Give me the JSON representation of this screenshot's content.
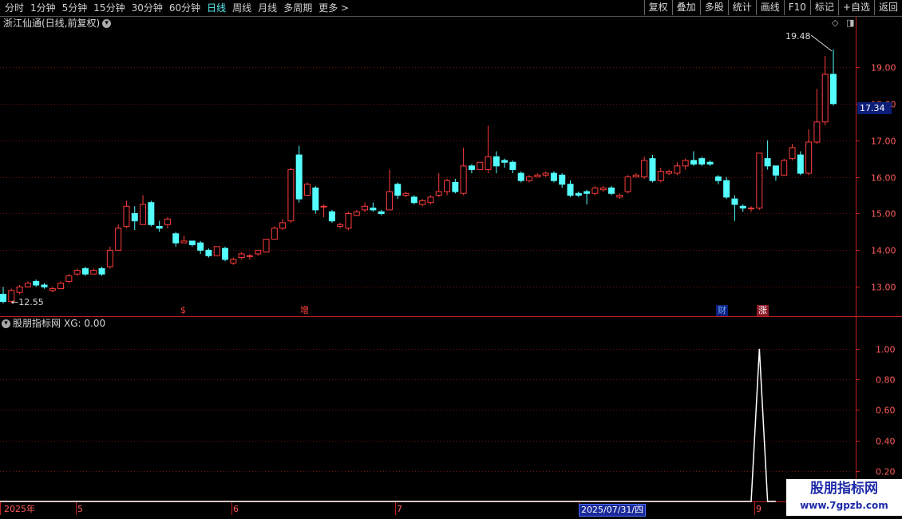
{
  "toolbar": {
    "periods": [
      "分时",
      "1分钟",
      "5分钟",
      "15分钟",
      "30分钟",
      "60分钟",
      "日线",
      "周线",
      "月线",
      "多周期",
      "更多 >"
    ],
    "active_period": "日线",
    "buttons": [
      "复权",
      "叠加",
      "多股",
      "统计",
      "画线",
      "F10",
      "标记",
      "+自选",
      "返回"
    ]
  },
  "chart_title": "浙江仙通(日线,前复权)",
  "indicator": {
    "name": "股朋指标网",
    "xg_label": "XG: 0.00"
  },
  "current_price": "17.34",
  "markers": {
    "s": "$",
    "zeng": "增",
    "cai": "财",
    "zhang": "涨"
  },
  "watermark": {
    "line1": "股朋指标网",
    "line2": "www.7gpzb.com"
  },
  "dates": {
    "year": "2025年",
    "m5": "5",
    "m6": "6",
    "m7": "7",
    "highlight": "2025/07/31/四",
    "m9": "9"
  },
  "colors": {
    "up": "#ff3c3c",
    "down": "#54ffff",
    "grid": "#7a1010",
    "axis": "#c22020",
    "bg": "#000000",
    "indicator_line": "#ffffff"
  },
  "chart_data": [
    {
      "type": "candlestick",
      "title": "浙江仙通(日线,前复权)",
      "y_ticks": [
        "13.00",
        "14.00",
        "15.00",
        "16.00",
        "17.00",
        "18.00",
        "19.00"
      ],
      "ylim": [
        12.2,
        20.0
      ],
      "high_label": "19.48",
      "low_label": "12.55",
      "candles": [
        [
          12.8,
          12.6,
          12.55,
          13.0
        ],
        [
          12.6,
          12.9,
          12.55,
          12.95
        ],
        [
          12.85,
          13.0,
          12.8,
          13.05
        ],
        [
          13.0,
          13.1,
          13.0,
          13.15
        ],
        [
          13.15,
          13.05,
          13.0,
          13.2
        ],
        [
          13.05,
          13.0,
          12.95,
          13.1
        ],
        [
          12.9,
          12.95,
          12.85,
          13.0
        ],
        [
          12.95,
          13.1,
          12.95,
          13.15
        ],
        [
          13.15,
          13.3,
          13.1,
          13.35
        ],
        [
          13.35,
          13.45,
          13.3,
          13.5
        ],
        [
          13.5,
          13.35,
          13.3,
          13.55
        ],
        [
          13.35,
          13.45,
          13.35,
          13.5
        ],
        [
          13.5,
          13.35,
          13.3,
          13.55
        ],
        [
          13.55,
          14.0,
          13.5,
          14.1
        ],
        [
          14.0,
          14.6,
          14.0,
          14.7
        ],
        [
          14.65,
          15.2,
          14.6,
          15.35
        ],
        [
          15.0,
          14.8,
          14.55,
          15.2
        ],
        [
          14.7,
          15.25,
          14.7,
          15.5
        ],
        [
          15.3,
          14.7,
          14.65,
          15.35
        ],
        [
          14.65,
          14.6,
          14.5,
          14.8
        ],
        [
          14.7,
          14.85,
          14.6,
          14.9
        ],
        [
          14.45,
          14.2,
          14.1,
          14.5
        ],
        [
          14.2,
          14.25,
          14.2,
          14.4
        ],
        [
          14.25,
          14.15,
          14.1,
          14.25
        ],
        [
          14.2,
          14.0,
          13.9,
          14.25
        ],
        [
          14.0,
          13.85,
          13.8,
          14.05
        ],
        [
          13.85,
          14.1,
          13.85,
          14.1
        ],
        [
          14.05,
          13.75,
          13.7,
          14.1
        ],
        [
          13.65,
          13.75,
          13.6,
          13.8
        ],
        [
          13.8,
          13.9,
          13.75,
          13.95
        ],
        [
          13.85,
          13.85,
          13.75,
          13.9
        ],
        [
          13.9,
          14.0,
          13.85,
          14.0
        ],
        [
          13.95,
          14.3,
          13.95,
          14.3
        ],
        [
          14.3,
          14.6,
          14.3,
          14.65
        ],
        [
          14.6,
          14.75,
          14.55,
          14.85
        ],
        [
          14.8,
          16.2,
          14.75,
          16.25
        ],
        [
          16.6,
          15.4,
          15.3,
          16.85
        ],
        [
          15.5,
          15.8,
          15.5,
          15.85
        ],
        [
          15.7,
          15.1,
          15.0,
          15.75
        ],
        [
          15.2,
          15.2,
          14.9,
          15.25
        ],
        [
          15.05,
          14.8,
          14.75,
          15.1
        ],
        [
          14.65,
          14.7,
          14.6,
          14.75
        ],
        [
          14.6,
          15.0,
          14.55,
          15.05
        ],
        [
          14.95,
          15.05,
          14.95,
          15.1
        ],
        [
          15.1,
          15.2,
          15.05,
          15.3
        ],
        [
          15.15,
          15.1,
          15.05,
          15.3
        ],
        [
          15.05,
          15.0,
          14.95,
          15.1
        ],
        [
          15.1,
          15.6,
          15.1,
          16.2
        ],
        [
          15.8,
          15.5,
          15.4,
          15.85
        ],
        [
          15.5,
          15.55,
          15.45,
          15.6
        ],
        [
          15.45,
          15.3,
          15.25,
          15.5
        ],
        [
          15.25,
          15.35,
          15.2,
          15.4
        ],
        [
          15.3,
          15.45,
          15.25,
          15.5
        ],
        [
          15.5,
          15.6,
          15.45,
          16.1
        ],
        [
          15.6,
          15.9,
          15.5,
          15.95
        ],
        [
          15.85,
          15.6,
          15.55,
          15.95
        ],
        [
          15.55,
          16.3,
          15.5,
          16.8
        ],
        [
          16.3,
          16.2,
          16.1,
          16.35
        ],
        [
          16.2,
          16.4,
          16.2,
          16.4
        ],
        [
          16.2,
          16.55,
          16.1,
          17.4
        ],
        [
          16.55,
          16.3,
          16.1,
          16.7
        ],
        [
          16.45,
          16.4,
          16.25,
          16.5
        ],
        [
          16.4,
          16.2,
          16.1,
          16.45
        ],
        [
          16.1,
          15.9,
          15.85,
          16.15
        ],
        [
          15.9,
          16.0,
          15.85,
          16.05
        ],
        [
          16.0,
          16.05,
          16.0,
          16.1
        ],
        [
          16.05,
          16.1,
          16.0,
          16.15
        ],
        [
          16.1,
          15.9,
          15.85,
          16.15
        ],
        [
          16.05,
          15.8,
          15.7,
          16.1
        ],
        [
          15.8,
          15.5,
          15.45,
          15.9
        ],
        [
          15.55,
          15.5,
          15.45,
          15.6
        ],
        [
          15.6,
          15.55,
          15.25,
          15.65
        ],
        [
          15.55,
          15.7,
          15.5,
          15.75
        ],
        [
          15.65,
          15.7,
          15.6,
          15.75
        ],
        [
          15.7,
          15.55,
          15.5,
          15.75
        ],
        [
          15.45,
          15.5,
          15.4,
          15.55
        ],
        [
          15.6,
          16.0,
          15.55,
          16.05
        ],
        [
          16.0,
          16.05,
          16.0,
          16.1
        ],
        [
          16.0,
          16.45,
          15.95,
          16.55
        ],
        [
          16.5,
          15.9,
          15.85,
          16.6
        ],
        [
          15.9,
          16.15,
          15.85,
          16.25
        ],
        [
          16.1,
          16.15,
          16.05,
          16.2
        ],
        [
          16.1,
          16.3,
          16.05,
          16.4
        ],
        [
          16.3,
          16.45,
          16.2,
          16.5
        ],
        [
          16.45,
          16.35,
          16.3,
          16.7
        ],
        [
          16.5,
          16.35,
          16.3,
          16.55
        ],
        [
          16.4,
          16.35,
          16.3,
          16.45
        ],
        [
          16.0,
          15.9,
          15.8,
          16.05
        ],
        [
          15.9,
          15.45,
          15.4,
          16.0
        ],
        [
          15.4,
          15.25,
          14.8,
          15.5
        ],
        [
          15.2,
          15.15,
          15.05,
          15.25
        ],
        [
          15.15,
          15.15,
          15.05,
          15.2
        ],
        [
          15.15,
          16.65,
          15.1,
          16.65
        ],
        [
          16.5,
          16.3,
          16.2,
          17.0
        ],
        [
          16.3,
          16.05,
          15.9,
          16.3
        ],
        [
          16.05,
          16.45,
          16.05,
          16.5
        ],
        [
          16.5,
          16.8,
          16.45,
          16.9
        ],
        [
          16.6,
          16.1,
          16.05,
          16.7
        ],
        [
          16.1,
          16.95,
          16.05,
          17.3
        ],
        [
          16.95,
          17.5,
          16.9,
          18.4
        ],
        [
          17.5,
          18.8,
          17.4,
          19.3
        ],
        [
          18.8,
          18.0,
          17.95,
          19.48
        ]
      ]
    },
    {
      "type": "line",
      "title": "股朋指标网",
      "y_ticks": [
        "0.20",
        "0.40",
        "0.60",
        "0.80",
        "1.00"
      ],
      "ylim": [
        0,
        1.12
      ],
      "series": [
        {
          "name": "XG",
          "spike_candle_index": 92
        }
      ]
    }
  ]
}
